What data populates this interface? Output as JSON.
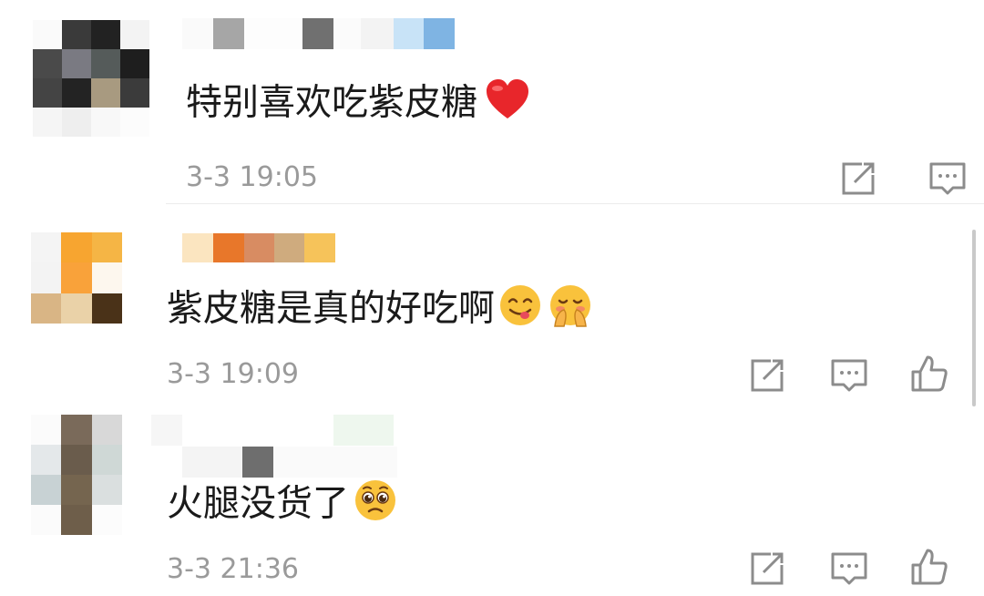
{
  "comments": [
    {
      "text": "特别喜欢吃紫皮糖",
      "emoji": [
        "heart-emoji"
      ],
      "time": "3-3 19:05",
      "actions": [
        "share-icon",
        "reply-icon"
      ]
    },
    {
      "text": "紫皮糖是真的好吃啊",
      "emoji": [
        "yum-emoji",
        "shy-emoji"
      ],
      "time": "3-3 19:09",
      "actions": [
        "share-icon",
        "reply-icon",
        "like-icon"
      ]
    },
    {
      "text": "火腿没货了",
      "emoji": [
        "pleading-emoji"
      ],
      "time": "3-3 21:36",
      "actions": [
        "share-icon",
        "reply-icon",
        "like-icon"
      ]
    }
  ],
  "colors": {
    "text": "#1a1a1a",
    "timestamp": "#9a9a9a",
    "icon": "#8c8c8c",
    "heart": "#e8262b",
    "emoji_face": "#f9c23c"
  }
}
